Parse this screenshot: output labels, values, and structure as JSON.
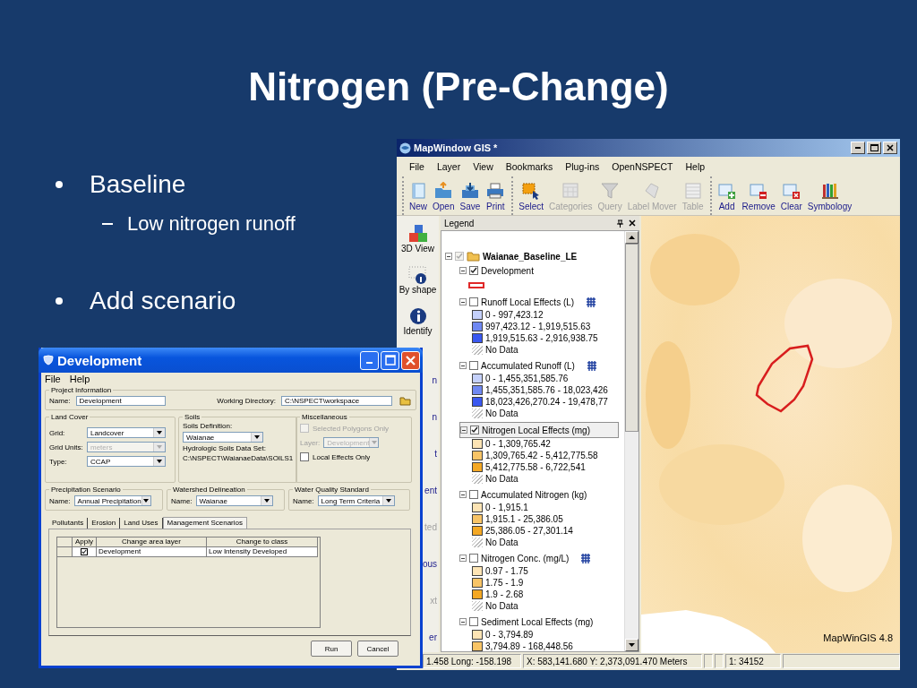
{
  "slide": {
    "title": "Nitrogen (Pre-Change)",
    "bullets": [
      {
        "text": "Baseline",
        "children": [
          {
            "text": "Low nitrogen runoff"
          }
        ]
      },
      {
        "text": "Add scenario"
      }
    ]
  },
  "map_window": {
    "title": "MapWindow GIS *",
    "menu": [
      "File",
      "Layer",
      "View",
      "Bookmarks",
      "Plug-ins",
      "OpenNSPECT",
      "Help"
    ],
    "toolbar": [
      [
        {
          "label": "New",
          "disabled": false
        },
        {
          "label": "Open",
          "disabled": false
        },
        {
          "label": "Save",
          "disabled": false
        },
        {
          "label": "Print",
          "disabled": false
        }
      ],
      [
        {
          "label": "Select",
          "disabled": false
        },
        {
          "label": "Categories",
          "disabled": true
        },
        {
          "label": "Query",
          "disabled": true
        },
        {
          "label": "Label Mover",
          "disabled": true
        },
        {
          "label": "Table",
          "disabled": true
        }
      ],
      [
        {
          "label": "Add",
          "disabled": false
        },
        {
          "label": "Remove",
          "disabled": false
        },
        {
          "label": "Clear",
          "disabled": false
        },
        {
          "label": "Symbology",
          "disabled": false
        }
      ]
    ],
    "side_toolbar": [
      {
        "label": "3D View",
        "kind": "tool",
        "disabled": false
      },
      {
        "label": "By shape",
        "kind": "tool",
        "disabled": false
      },
      {
        "label": "Identify",
        "kind": "tool",
        "disabled": false
      },
      {
        "label": "n",
        "kind": "partial",
        "disabled": false
      },
      {
        "label": "n",
        "kind": "partial",
        "disabled": false
      },
      {
        "label": "t",
        "kind": "partial",
        "disabled": false
      },
      {
        "label": "ent",
        "kind": "partial",
        "disabled": false
      },
      {
        "label": "ted",
        "kind": "partial",
        "disabled": true
      },
      {
        "label": "ous",
        "kind": "partial",
        "disabled": false
      },
      {
        "label": "xt",
        "kind": "partial",
        "disabled": true
      },
      {
        "label": "er",
        "kind": "partial",
        "disabled": false
      }
    ],
    "legend": {
      "title": "Legend",
      "group": {
        "name": "Waianae_Baseline_LE",
        "checked": true,
        "expanded": true,
        "layers": [
          {
            "name": "Development",
            "checked": true,
            "expanded": true,
            "selected": false,
            "raster": false,
            "entries": [
              {
                "kind": "outline",
                "color": "#e02828"
              }
            ]
          },
          {
            "name": "Runoff Local Effects (L)",
            "checked": false,
            "expanded": true,
            "selected": false,
            "raster": true,
            "entries": [
              {
                "kind": "fill",
                "color": "#c4d0fa",
                "label": "0 - 997,423.12"
              },
              {
                "kind": "fill",
                "color": "#6f88f2",
                "label": "997,423.12 - 1,919,515.63"
              },
              {
                "kind": "fill",
                "color": "#3a58f0",
                "label": "1,919,515.63 - 2,916,938.75"
              },
              {
                "kind": "hatch",
                "label": "No Data"
              }
            ]
          },
          {
            "name": "Accumulated Runoff (L)",
            "checked": false,
            "expanded": true,
            "selected": false,
            "raster": true,
            "entries": [
              {
                "kind": "fill",
                "color": "#c4d0fa",
                "label": "0 - 1,455,351,585.76"
              },
              {
                "kind": "fill",
                "color": "#6f88f2",
                "label": "1,455,351,585.76 - 18,023,426"
              },
              {
                "kind": "fill",
                "color": "#3a58f0",
                "label": "18,023,426,270.24 - 19,478,77"
              },
              {
                "kind": "hatch",
                "label": "No Data"
              }
            ]
          },
          {
            "name": "Nitrogen Local Effects (mg)",
            "checked": true,
            "expanded": true,
            "selected": true,
            "raster": false,
            "entries": [
              {
                "kind": "fill",
                "color": "#fde4b4",
                "label": "0 - 1,309,765.42"
              },
              {
                "kind": "fill",
                "color": "#f8c466",
                "label": "1,309,765.42 - 5,412,775.58"
              },
              {
                "kind": "fill",
                "color": "#f4a824",
                "label": "5,412,775.58 - 6,722,541"
              },
              {
                "kind": "hatch",
                "label": "No Data"
              }
            ]
          },
          {
            "name": "Accumulated Nitrogen (kg)",
            "checked": false,
            "expanded": true,
            "selected": false,
            "raster": false,
            "entries": [
              {
                "kind": "fill",
                "color": "#fde4b4",
                "label": "0 - 1,915.1"
              },
              {
                "kind": "fill",
                "color": "#f8c466",
                "label": "1,915.1 - 25,386.05"
              },
              {
                "kind": "fill",
                "color": "#f4a824",
                "label": "25,386.05 - 27,301.14"
              },
              {
                "kind": "hatch",
                "label": "No Data"
              }
            ]
          },
          {
            "name": "Nitrogen Conc. (mg/L)",
            "checked": false,
            "expanded": true,
            "selected": false,
            "raster": true,
            "entries": [
              {
                "kind": "fill",
                "color": "#fde4b4",
                "label": "0.97 - 1.75"
              },
              {
                "kind": "fill",
                "color": "#f8c466",
                "label": "1.75 - 1.9"
              },
              {
                "kind": "fill",
                "color": "#f4a824",
                "label": "1.9 - 2.68"
              },
              {
                "kind": "hatch",
                "label": "No Data"
              }
            ]
          },
          {
            "name": "Sediment Local Effects (mg)",
            "checked": false,
            "expanded": true,
            "selected": false,
            "raster": false,
            "entries": [
              {
                "kind": "fill",
                "color": "#fde4b4",
                "label": "0 - 3,794.89"
              },
              {
                "kind": "fill",
                "color": "#f8c466",
                "label": "3,794.89 - 168,448.56"
              }
            ]
          }
        ]
      }
    },
    "map": {
      "label": "MapWinGIS 4.8"
    },
    "status_bar": [
      "1.458 Long: -158.198",
      "X: 583,141.680 Y: 2,373,091.470 Meters",
      "1: 34152"
    ]
  },
  "development_dialog": {
    "title": "Development",
    "menu": [
      "File",
      "Help"
    ],
    "project_information": {
      "title": "Project Information",
      "name_label": "Name:",
      "name_value": "Development",
      "dir_label": "Working Directory:",
      "dir_value": "C:\\NSPECT\\workspace"
    },
    "land_cover": {
      "title": "Land Cover",
      "fields": [
        {
          "label": "Grid:",
          "value": "Landcover",
          "disabled": false
        },
        {
          "label": "Grid Units:",
          "value": "meters",
          "disabled": true
        },
        {
          "label": "Type:",
          "value": "CCAP",
          "disabled": false
        }
      ]
    },
    "soils": {
      "title": "Soils",
      "definition_label": "Soils Definition:",
      "definition_value": "Waianae",
      "data_set_label": "Hydrologic Soils Data Set:",
      "data_set_path": "C:\\NSPECT\\WaianaeData\\SOILS1"
    },
    "miscellaneous": {
      "title": "Miscellaneous",
      "selected_polygons": {
        "label": "Selected Polygons Only",
        "checked": false,
        "disabled": true
      },
      "layer": {
        "label": "Layer:",
        "value": "Development",
        "disabled": true
      },
      "local_effects": {
        "label": "Local Effects Only",
        "checked": false,
        "disabled": false
      }
    },
    "scenario_groups": [
      {
        "title": "Precipitation Scenario",
        "label": "Name:",
        "value": "Annual Precipitation"
      },
      {
        "title": "Watershed Delineation",
        "label": "Name:",
        "value": "Waianae"
      },
      {
        "title": "Water Quality Standard",
        "label": "Name:",
        "value": "Long Term Criteria"
      }
    ],
    "tabs": [
      {
        "label": "Pollutants",
        "selected": false
      },
      {
        "label": "Erosion",
        "selected": false
      },
      {
        "label": "Land Uses",
        "selected": false
      },
      {
        "label": "Management Scenarios",
        "selected": true
      }
    ],
    "table": {
      "columns": [
        "Apply",
        "Change area layer",
        "Change to class"
      ],
      "rows": [
        {
          "apply": true,
          "layer": "Development",
          "class": "Low Intensity Developed"
        }
      ]
    },
    "buttons": [
      "Run",
      "Cancel"
    ]
  }
}
